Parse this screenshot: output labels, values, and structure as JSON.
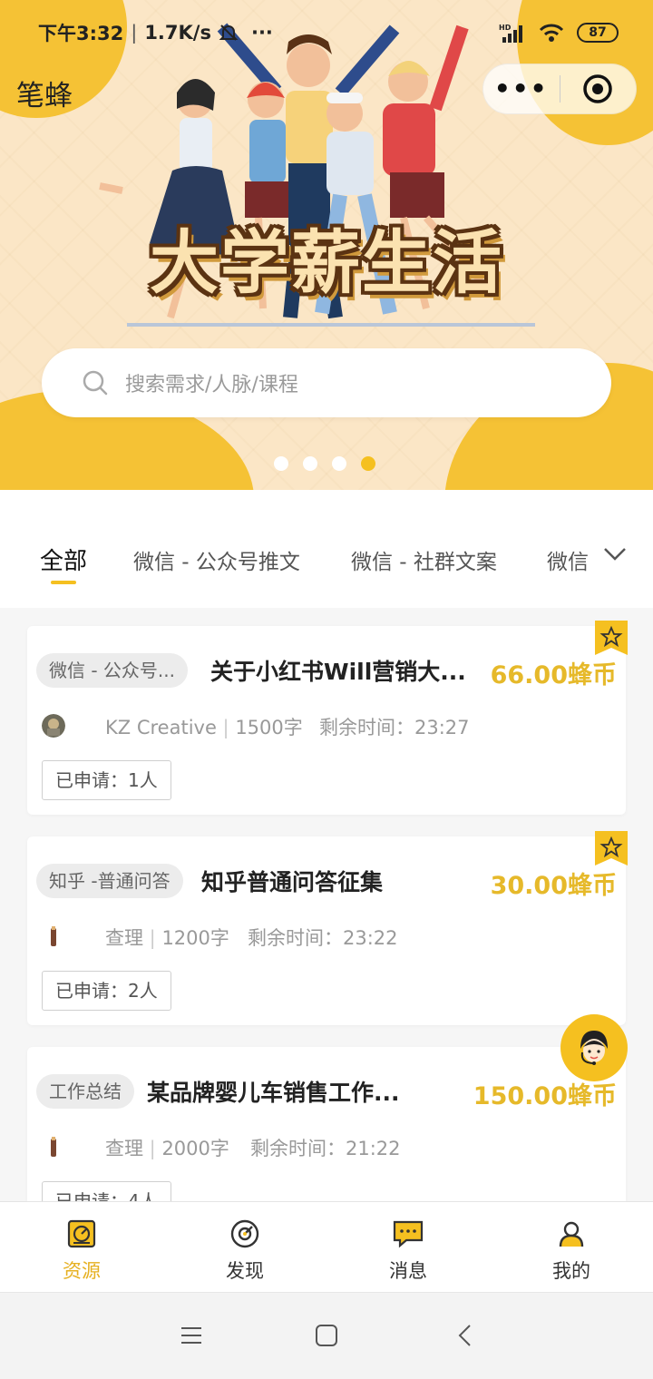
{
  "status_bar": {
    "time": "下午3:32",
    "speed": "1.7K/s",
    "more": "···",
    "network": "HD",
    "battery": "87"
  },
  "app": {
    "name": "笔蜂"
  },
  "capsule": {
    "more": "•••"
  },
  "banner": {
    "title": "大学薪生活",
    "dots_total": 4,
    "active_dot": 4
  },
  "search": {
    "placeholder": "搜索需求/人脉/课程"
  },
  "tabs": [
    {
      "label": "全部",
      "active": true
    },
    {
      "label": "微信 - 公众号推文"
    },
    {
      "label": "微信 - 社群文案"
    },
    {
      "label": "微信"
    }
  ],
  "tasks": [
    {
      "tag": "微信 - 公众号...",
      "title": "关于小红书Will营销大...",
      "price": "66.00蜂币",
      "author": "KZ Creative",
      "words": "1500字",
      "remaining": "剩余时间：23:27",
      "applied": "已申请：1人",
      "featured": true
    },
    {
      "tag": "知乎 -普通问答",
      "title": "知乎普通问答征集",
      "price": "30.00蜂币",
      "author": "查理",
      "words": "1200字",
      "remaining": "剩余时间：23:22",
      "applied": "已申请：2人",
      "featured": true
    },
    {
      "tag": "工作总结",
      "title": "某品牌婴儿车销售工作...",
      "price": "150.00蜂币",
      "author": "查理",
      "words": "2000字",
      "remaining": "剩余时间：21:22",
      "applied": "已申请：4人",
      "featured": false
    }
  ],
  "bottom_nav": [
    {
      "label": "资源",
      "icon": "resource-icon",
      "active": true
    },
    {
      "label": "发现",
      "icon": "discover-icon"
    },
    {
      "label": "消息",
      "icon": "message-icon"
    },
    {
      "label": "我的",
      "icon": "profile-icon"
    }
  ],
  "colors": {
    "accent": "#f5c020",
    "price": "#e6b92a",
    "banner_bg": "#fbe6c6"
  }
}
